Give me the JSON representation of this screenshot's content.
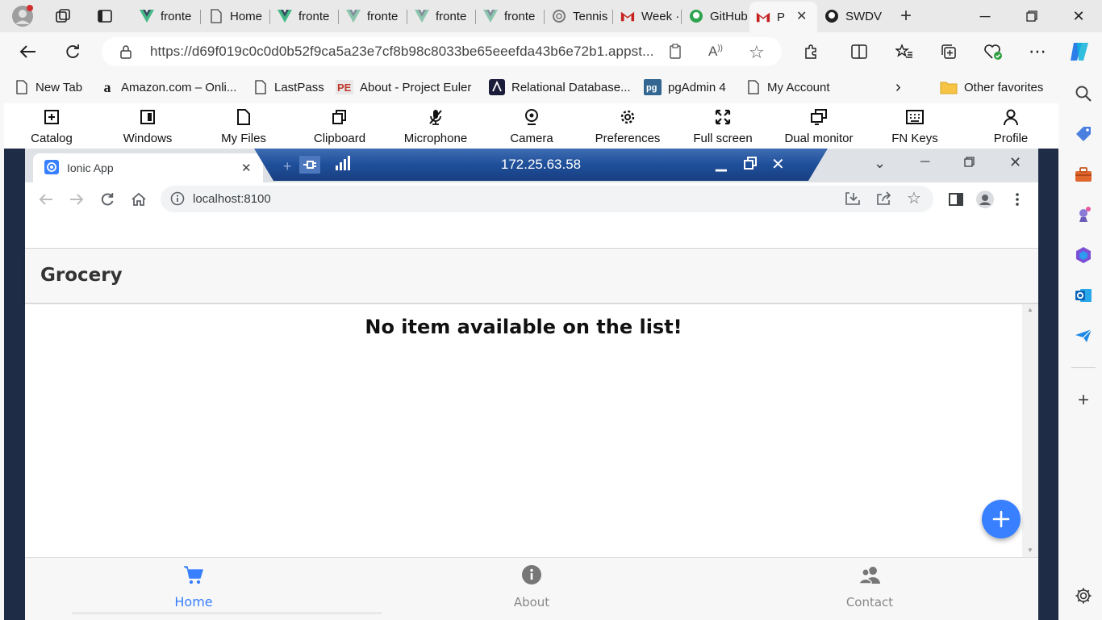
{
  "edge": {
    "tabs": [
      {
        "label": "fronte",
        "icon": "vue-icon"
      },
      {
        "label": "Home",
        "icon": "page-icon"
      },
      {
        "label": "fronte",
        "icon": "vue-icon"
      },
      {
        "label": "fronte",
        "icon": "vue-icon"
      },
      {
        "label": "fronte",
        "icon": "vue-icon"
      },
      {
        "label": "fronte",
        "icon": "vue-icon"
      },
      {
        "label": "Tennis",
        "icon": "openai-icon"
      },
      {
        "label": "Week ·",
        "icon": "gmail-icon"
      },
      {
        "label": "GitHub",
        "icon": "github-icon"
      },
      {
        "label": "P",
        "icon": "gmail-icon",
        "active": true
      },
      {
        "label": "SWDV",
        "icon": "github-icon"
      }
    ],
    "address": {
      "url": "https://d69f019c0c0d0b52f9ca5a23e7cf8b98c8033be65eeefda43b6e72b1.appst..."
    },
    "favorites": [
      {
        "label": "New Tab",
        "icon": "page-icon"
      },
      {
        "label": "Amazon.com – Onli...",
        "icon": "amazon-icon"
      },
      {
        "label": "LastPass",
        "icon": "page-icon"
      },
      {
        "label": "About - Project Euler",
        "icon": "project-euler-icon"
      },
      {
        "label": "Relational Database...",
        "icon": "database-icon"
      },
      {
        "label": "pgAdmin 4",
        "icon": "pgadmin-icon"
      },
      {
        "label": "My Account",
        "icon": "page-icon"
      }
    ],
    "other_favorites": "Other favorites",
    "colors": {
      "accent": "#3880ff",
      "gmail_red": "#c5221f",
      "vue_green": "#41b883"
    }
  },
  "remote_toolbar": {
    "items": [
      "Catalog",
      "Windows",
      "My Files",
      "Clipboard",
      "Microphone",
      "Camera",
      "Preferences",
      "Full screen",
      "Dual monitor",
      "FN Keys",
      "Profile"
    ]
  },
  "remote_session": {
    "ip": "172.25.63.58"
  },
  "chrome": {
    "tab_title": "Ionic App",
    "url": "localhost:8100"
  },
  "app": {
    "title": "Grocery",
    "empty_message": "No item available on the list!",
    "tabs": [
      {
        "label": "Home",
        "icon": "cart-icon",
        "selected": true
      },
      {
        "label": "About",
        "icon": "info-icon",
        "selected": false
      },
      {
        "label": "Contact",
        "icon": "people-icon",
        "selected": false
      }
    ]
  }
}
